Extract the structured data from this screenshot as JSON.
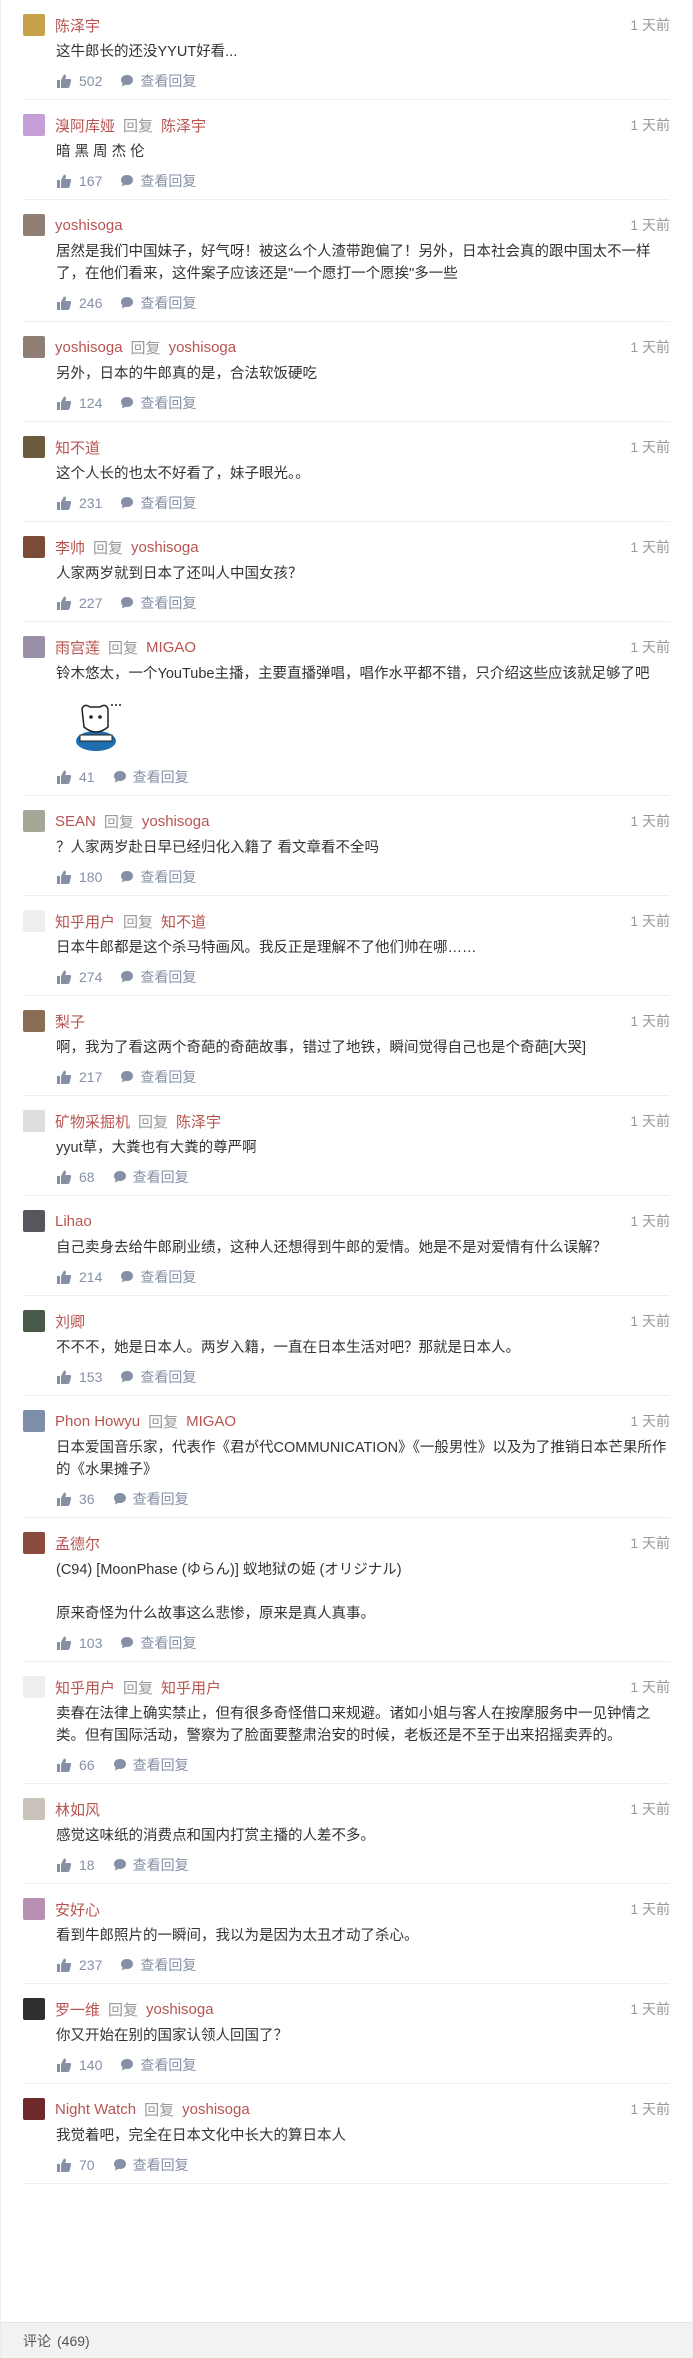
{
  "labels": {
    "reply": "回复",
    "view_replies": "查看回复"
  },
  "footer": {
    "label": "评论",
    "count": "(469)"
  },
  "comments": [
    {
      "user": "陈泽宇",
      "reply_to": "",
      "time": "1 天前",
      "text": [
        "这牛郎长的还没YYUT好看..."
      ],
      "likes": "502",
      "avatar_color": "#c7a24a"
    },
    {
      "user": "溴阿库娅",
      "reply_to": "陈泽宇",
      "time": "1 天前",
      "text": [
        "暗 黑 周 杰 伦"
      ],
      "likes": "167",
      "avatar_color": "#c79fd8"
    },
    {
      "user": "yoshisoga",
      "reply_to": "",
      "time": "1 天前",
      "text": [
        "居然是我们中国妹子，好气呀！被这么个人渣带跑偏了！另外，日本社会真的跟中国太不一样了，在他们看来，这件案子应该还是\"一个愿打一个愿挨\"多一些"
      ],
      "likes": "246",
      "avatar_color": "#8f7f74"
    },
    {
      "user": "yoshisoga",
      "reply_to": "yoshisoga",
      "time": "1 天前",
      "text": [
        "另外，日本的牛郎真的是，合法软饭硬吃"
      ],
      "likes": "124",
      "avatar_color": "#8f7f74"
    },
    {
      "user": "知不道",
      "reply_to": "",
      "time": "1 天前",
      "text": [
        "这个人长的也太不好看了，妹子眼光。。"
      ],
      "likes": "231",
      "avatar_color": "#6b5a3c"
    },
    {
      "user": "李帅",
      "reply_to": "yoshisoga",
      "time": "1 天前",
      "text": [
        "人家两岁就到日本了还叫人中国女孩？"
      ],
      "likes": "227",
      "avatar_color": "#7a4b35"
    },
    {
      "user": "雨宫莲",
      "reply_to": "MIGAO",
      "time": "1 天前",
      "text": [
        "铃木悠太，一个YouTube主播，主要直播弹唱，唱作水平都不错，只介绍这些应该就足够了吧"
      ],
      "likes": "41",
      "avatar_color": "#9a8fa8",
      "sticker": true
    },
    {
      "user": "SEAN",
      "reply_to": "yoshisoga",
      "time": "1 天前",
      "text": [
        "？人家两岁赴日早已经归化入籍了 看文章看不全吗"
      ],
      "likes": "180",
      "avatar_color": "#a5a897"
    },
    {
      "user": "知乎用户",
      "reply_to": "知不道",
      "time": "1 天前",
      "text": [
        "日本牛郎都是这个杀马特画风。我反正是理解不了他们帅在哪……"
      ],
      "likes": "274",
      "avatar_color": "#eeeeee"
    },
    {
      "user": "梨子",
      "reply_to": "",
      "time": "1 天前",
      "text": [
        "啊，我为了看这两个奇葩的奇葩故事，错过了地铁，瞬间觉得自己也是个奇葩[大哭]"
      ],
      "likes": "217",
      "avatar_color": "#8a6d55"
    },
    {
      "user": "矿物采掘机",
      "reply_to": "陈泽宇",
      "time": "1 天前",
      "text": [
        "yyut草，大粪也有大粪的尊严啊"
      ],
      "likes": "68",
      "avatar_color": "#dddddd"
    },
    {
      "user": "Lihao",
      "reply_to": "",
      "time": "1 天前",
      "text": [
        "自己卖身去给牛郎刷业绩，这种人还想得到牛郎的爱情。她是不是对爱情有什么误解？"
      ],
      "likes": "214",
      "avatar_color": "#55575c"
    },
    {
      "user": "刘卿",
      "reply_to": "",
      "time": "1 天前",
      "text": [
        "不不不，她是日本人。两岁入籍，一直在日本生活对吧？那就是日本人。"
      ],
      "likes": "153",
      "avatar_color": "#4a5a48"
    },
    {
      "user": "Phon Howyu",
      "reply_to": "MIGAO",
      "time": "1 天前",
      "text": [
        "日本爱国音乐家，代表作《君が代COMMUNICATION》《一般男性》以及为了推销日本芒果所作的《水果摊子》"
      ],
      "likes": "36",
      "avatar_color": "#7d8fa8"
    },
    {
      "user": "孟德尔",
      "reply_to": "",
      "time": "1 天前",
      "text": [
        "(C94) [MoonPhase (ゆらん)] 蚁地狱の姫 (オリジナル)",
        "",
        "原来奇怪为什么故事这么悲惨，原来是真人真事。"
      ],
      "likes": "103",
      "avatar_color": "#8a4a3e"
    },
    {
      "user": "知乎用户",
      "reply_to": "知乎用户",
      "time": "1 天前",
      "text": [
        "卖春在法律上确实禁止，但有很多奇怪借口来规避。诸如小姐与客人在按摩服务中一见钟情之类。但有国际活动，警察为了脸面要整肃治安的时候，老板还是不至于出来招摇卖弄的。"
      ],
      "likes": "66",
      "avatar_color": "#eeeeee"
    },
    {
      "user": "林如风",
      "reply_to": "",
      "time": "1 天前",
      "text": [
        "感觉这味纸的消费点和国内打赏主播的人差不多。"
      ],
      "likes": "18",
      "avatar_color": "#c9c2b8"
    },
    {
      "user": "安好心",
      "reply_to": "",
      "time": "1 天前",
      "text": [
        "看到牛郎照片的一瞬间，我以为是因为太丑才动了杀心。"
      ],
      "likes": "237",
      "avatar_color": "#b78fb0"
    },
    {
      "user": "罗一维",
      "reply_to": "yoshisoga",
      "time": "1 天前",
      "text": [
        "你又开始在别的国家认领人回国了？"
      ],
      "likes": "140",
      "avatar_color": "#2f2f2f"
    },
    {
      "user": "Night Watch",
      "reply_to": "yoshisoga",
      "time": "1 天前",
      "text": [
        "我觉着吧，完全在日本文化中长大的算日本人"
      ],
      "likes": "70",
      "avatar_color": "#6e2a2a"
    }
  ]
}
